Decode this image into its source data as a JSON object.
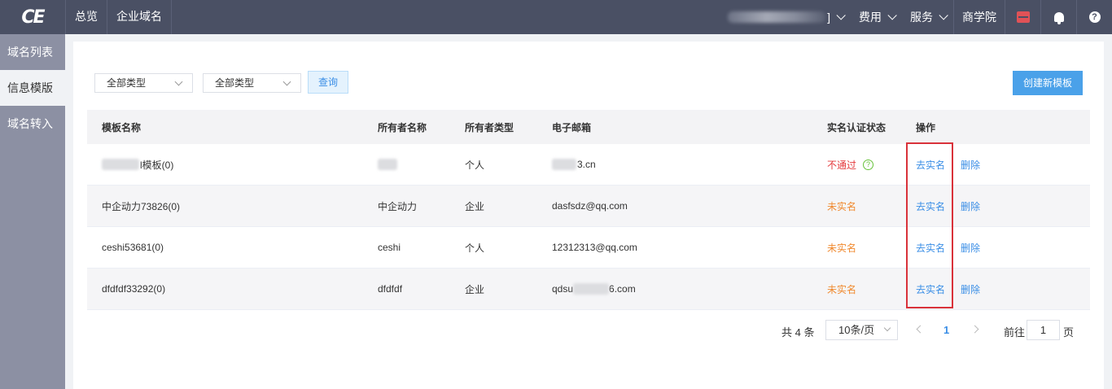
{
  "header": {
    "logo_text": "CE",
    "nav": [
      "总览",
      "企业域名"
    ],
    "user_bracket": "]",
    "fee": "费用",
    "service": "服务",
    "academy": "商学院"
  },
  "sidebar": {
    "items": [
      {
        "label": "域名列表"
      },
      {
        "label": "信息模版"
      },
      {
        "label": "域名转入"
      }
    ]
  },
  "filters": {
    "type1": "全部类型",
    "type2": "全部类型",
    "query": "查询",
    "create": "创建新模板"
  },
  "table": {
    "columns": [
      "模板名称",
      "所有者名称",
      "所有者类型",
      "电子邮箱",
      "实名认证状态",
      "操作"
    ],
    "rows": [
      {
        "name": "l模板(0)",
        "owner": "",
        "type": "个人",
        "email": "3.cn",
        "status": "不通过",
        "action1": "去实名",
        "action2": "删除"
      },
      {
        "name": "中企动力73826(0)",
        "owner": "中企动力",
        "type": "企业",
        "email": "dasfsdz@qq.com",
        "status": "未实名",
        "action1": "去实名",
        "action2": "删除"
      },
      {
        "name": "ceshi53681(0)",
        "owner": "ceshi",
        "type": "个人",
        "email": "12312313@qq.com",
        "status": "未实名",
        "action1": "去实名",
        "action2": "删除"
      },
      {
        "name": "dfdfdf33292(0)",
        "owner": "dfdfdf",
        "type": "企业",
        "email_prefix": "qdsu",
        "email_suffix": "6.com",
        "status": "未实名",
        "action1": "去实名",
        "action2": "删除"
      }
    ]
  },
  "pagination": {
    "total": "共 4 条",
    "page_size": "10条/页",
    "current_page": "1",
    "goto_label": "前往",
    "goto_value": "1",
    "page_unit": "页"
  },
  "colors": {
    "topbar": "#4a5064",
    "sidebar": "#8c90a3",
    "link": "#3a8ee6",
    "status_fail": "#e4393c",
    "status_unverified": "#f0892e",
    "highlight_box": "#d9323a"
  }
}
